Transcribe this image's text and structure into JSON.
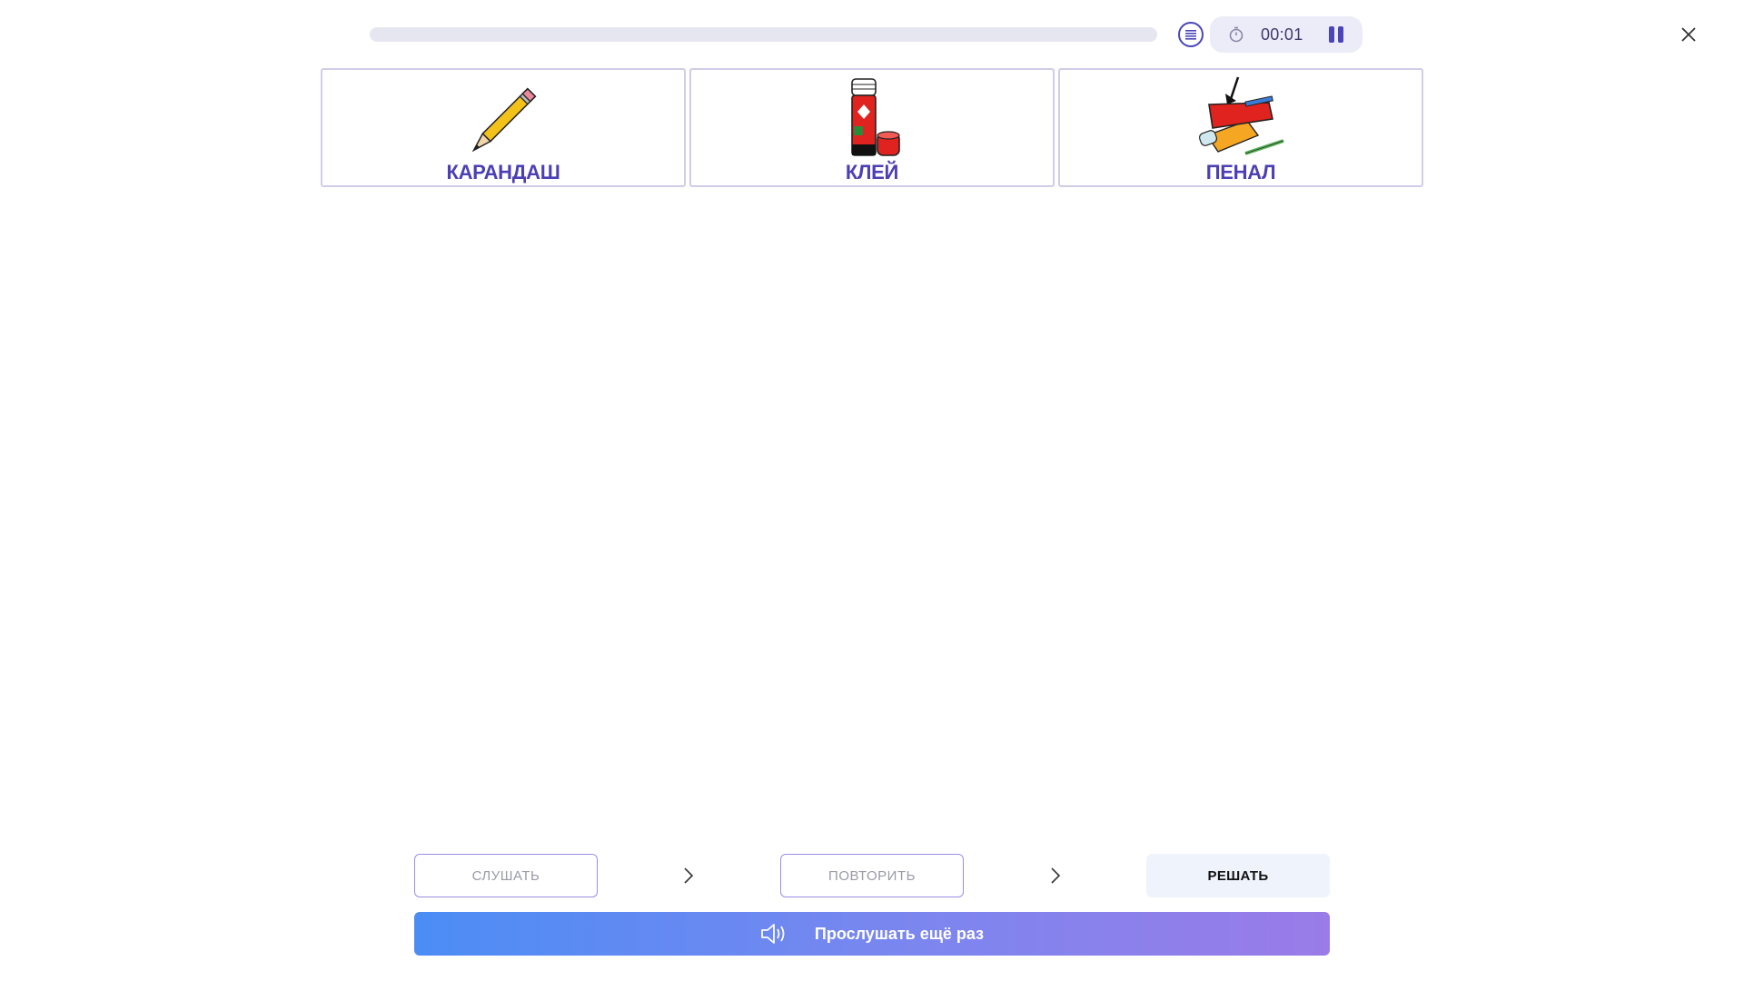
{
  "header": {
    "progress_fraction": 0.0,
    "timer": "00:01"
  },
  "cards": [
    {
      "label": "КАРАНДАШ",
      "icon": "pencil-icon"
    },
    {
      "label": "КЛЕЙ",
      "icon": "glue-stick-icon"
    },
    {
      "label": "ПЕНАЛ",
      "icon": "pencil-case-icon"
    }
  ],
  "steps": {
    "listen_label": "СЛУШАТЬ",
    "repeat_label": "ПОВТОРИТЬ",
    "solve_label": "РЕШАТЬ"
  },
  "replay": {
    "label": "Прослушать ещё раз",
    "icon": "speaker-icon"
  },
  "colors": {
    "accent": "#4b3fb3",
    "gradient_start": "#4b8df5",
    "gradient_end": "#9a7be8"
  }
}
